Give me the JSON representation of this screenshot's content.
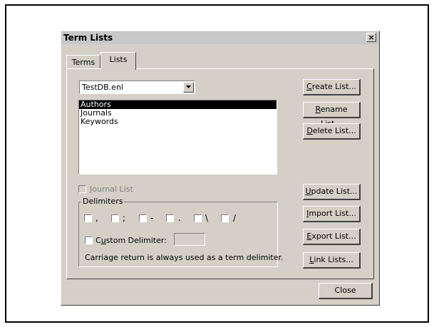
{
  "dialog": {
    "title": "Term Lists",
    "close_glyph": "×"
  },
  "tabs": [
    {
      "label": "Terms"
    },
    {
      "label": "Lists"
    }
  ],
  "library": {
    "selected": "TestDB.enl"
  },
  "lists": {
    "items": [
      "Authors",
      "Journals",
      "Keywords"
    ],
    "selected_index": 0
  },
  "buttons": {
    "create": {
      "pre": "",
      "acc": "C",
      "post": "reate List..."
    },
    "rename": {
      "pre": "",
      "acc": "R",
      "post": "ename List..."
    },
    "delete": {
      "pre": "",
      "acc": "D",
      "post": "elete List..."
    },
    "update": {
      "pre": "",
      "acc": "U",
      "post": "pdate List..."
    },
    "import": {
      "pre": "",
      "acc": "I",
      "post": "mport List..."
    },
    "export": {
      "pre": "",
      "acc": "E",
      "post": "xport List..."
    },
    "link": {
      "pre": "",
      "acc": "L",
      "post": "ink Lists..."
    },
    "close": "Close"
  },
  "journal_list": {
    "label": "Journal List",
    "checked": false,
    "enabled": false
  },
  "delimiters": {
    "legend": "Delimiters",
    "symbols": [
      ",",
      ";",
      "-",
      ".",
      "\\",
      "/"
    ],
    "custom": {
      "pre": "C",
      "acc": "u",
      "post": "stom Delimiter:"
    },
    "custom_value": "",
    "note": "Carriage return is always used as a term delimiter."
  },
  "colors": {
    "dialog_bg": "#d4d0c8",
    "selection_bg": "#000000",
    "selection_fg": "#ffffff"
  }
}
